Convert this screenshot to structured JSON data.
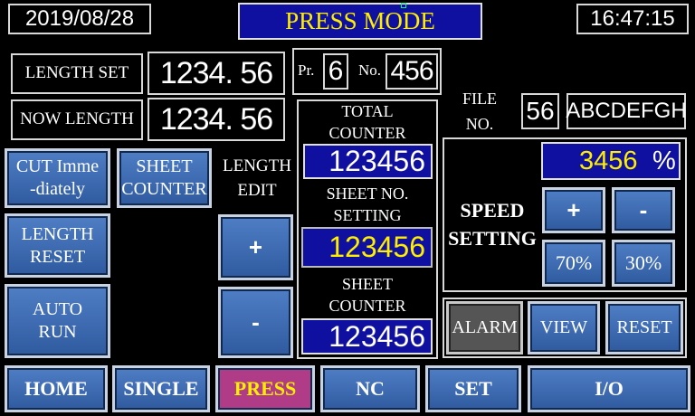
{
  "header": {
    "date": "2019/08/28",
    "mode_title": "PRESS MODE",
    "time": "16:47:15"
  },
  "length": {
    "set_label": "LENGTH SET",
    "set_value": "1234. 56",
    "now_label": "NOW LENGTH",
    "now_value": "1234. 56"
  },
  "program": {
    "pr_label": "Pr.",
    "pr_value": "6",
    "no_label": "No.",
    "no_value": "456"
  },
  "file": {
    "label_line1": "FILE",
    "label_line2": "NO.",
    "number": "56",
    "name": "ABCDEFGH"
  },
  "counters": {
    "total_line1": "TOTAL",
    "total_line2": "COUNTER",
    "total_value": "123456",
    "setting_line1": "SHEET NO.",
    "setting_line2": "SETTING",
    "setting_value": "123456",
    "sheet_line1": "SHEET",
    "sheet_line2": "COUNTER",
    "sheet_value": "123456"
  },
  "left_buttons": {
    "cut_line1": "CUT Imme",
    "cut_line2": "-diately",
    "sheet_counter_line1": "SHEET",
    "sheet_counter_line2": "COUNTER",
    "length_reset_line1": "LENGTH",
    "length_reset_line2": "RESET",
    "auto_run_line1": "AUTO",
    "auto_run_line2": "RUN"
  },
  "length_edit": {
    "line1": "LENGTH",
    "line2": "EDIT",
    "plus": "+",
    "minus": "-"
  },
  "speed": {
    "value": "3456",
    "unit": "%",
    "label_line1": "SPEED",
    "label_line2": "SETTING",
    "plus": "+",
    "minus": "-",
    "preset1": "70%",
    "preset2": "30%"
  },
  "actions": {
    "alarm": "ALARM",
    "view": "VIEW",
    "reset": "RESET"
  },
  "nav": [
    "HOME",
    "SINGLE",
    "PRESS",
    "NC",
    "SET",
    "I/O"
  ],
  "colors": {
    "title_bg": "#1010a0",
    "title_text": "#ffee00",
    "button_blue": "#3d6bb3",
    "active_nav": "#b03c88"
  }
}
